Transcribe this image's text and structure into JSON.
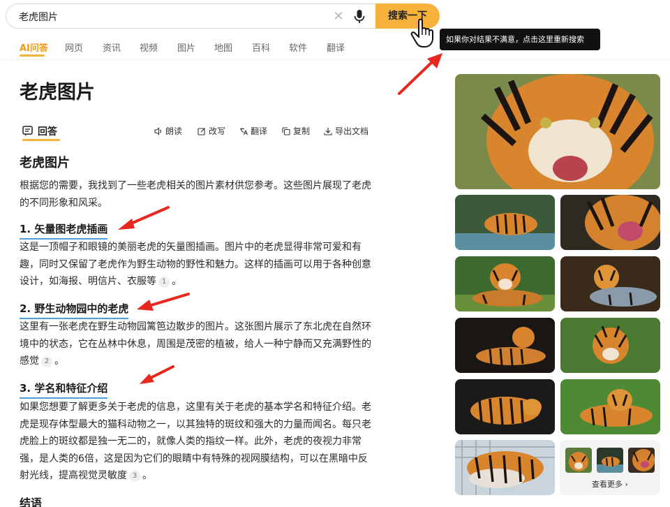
{
  "search": {
    "query": "老虎图片",
    "button_label": "搜索一下"
  },
  "tooltip": {
    "text": "如果你对结果不满意，点击这里重新搜索"
  },
  "tabs": [
    {
      "label": "AI问答",
      "active": true
    },
    {
      "label": "网页"
    },
    {
      "label": "资讯"
    },
    {
      "label": "视频"
    },
    {
      "label": "图片"
    },
    {
      "label": "地图"
    },
    {
      "label": "百科"
    },
    {
      "label": "软件"
    },
    {
      "label": "翻译"
    }
  ],
  "main": {
    "title": "老虎图片",
    "answer_tab": "回答",
    "tools": {
      "read": "朗读",
      "rewrite": "改写",
      "translate": "翻译",
      "copy": "复制",
      "export": "导出文档"
    },
    "heading": "老虎图片",
    "intro": "根据您的需要，我找到了一些老虎相关的图片素材供您参考。这些图片展现了老虎的不同形象和风采。",
    "sections": [
      {
        "title": "1. 矢量图老虎插画",
        "text": "这是一顶帽子和眼镜的美丽老虎的矢量图插画。图片中的老虎显得非常可爱和有趣，同时又保留了老虎作为野生动物的野性和魅力。这样的插画可以用于各种创意设计，如海报、明信片、衣服等",
        "ref": "1"
      },
      {
        "title": "2. 野生动物园中的老虎",
        "text": "这里有一张老虎在野生动物园篱笆边散步的图片。这张图片展示了东北虎在自然环境中的状态，它在丛林中休息，周围是茂密的植被，给人一种宁静而又充满野性的感觉",
        "ref": "2"
      },
      {
        "title": "3. 学名和特征介绍",
        "text": "如果您想要了解更多关于老虎的信息，这里有关于老虎的基本学名和特征介绍。老虎是现存体型最大的猫科动物之一，以其独特的斑纹和强大的力量而闻名。每只老虎脸上的斑纹都是独一无二的，就像人类的指纹一样。此外，老虎的夜视力非常强，是人类的6倍，这是因为它们的眼睛中有特殊的视网膜结构，可以在黑暗中反射光线，提高视觉灵敏度",
        "ref": "3"
      }
    ],
    "conclusion_heading": "结语"
  },
  "images": {
    "more_label": "查看更多 ›"
  },
  "icons": [
    "clear-icon",
    "mic-icon",
    "pointing-hand-icon",
    "answer-icon",
    "speaker-icon",
    "edit-icon",
    "translate-icon",
    "copy-icon",
    "export-icon",
    "red-arrow"
  ],
  "colors": {
    "accent": "#f7b23c",
    "active_tab": "#f39a12",
    "section_underline": "#4a9fe0",
    "arrow": "#e8281e"
  }
}
